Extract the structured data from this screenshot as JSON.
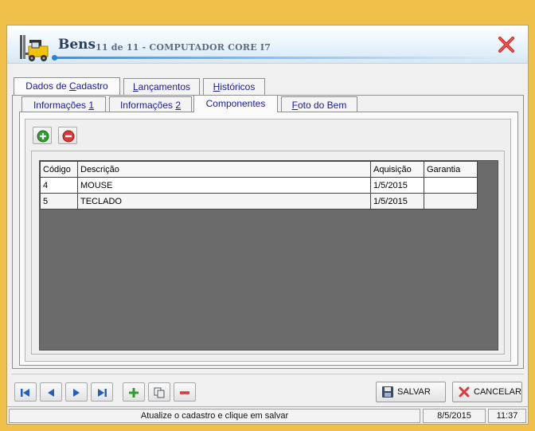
{
  "header": {
    "title": "Bens",
    "subtitle": "11 de 11 - COMPUTADOR CORE I7"
  },
  "tabs_top": [
    {
      "label_pre": "Dados de ",
      "label_u": "C",
      "label_post": "adastro"
    },
    {
      "label_pre": "",
      "label_u": "L",
      "label_post": "ançamentos"
    },
    {
      "label_pre": "",
      "label_u": "H",
      "label_post": "istóricos"
    }
  ],
  "tabs_sub": [
    {
      "label_pre": "Informações ",
      "label_u": "1",
      "label_post": ""
    },
    {
      "label_pre": "Informações ",
      "label_u": "2",
      "label_post": ""
    },
    {
      "label_pre": "",
      "label_u": "",
      "label_post": "Componentes"
    },
    {
      "label_pre": "",
      "label_u": "F",
      "label_post": "oto do Bem"
    }
  ],
  "grid": {
    "columns": [
      "Código",
      "Descrição",
      "Aquisição",
      "Garantia"
    ],
    "rows": [
      [
        "4",
        "MOUSE",
        "1/5/2015",
        ""
      ],
      [
        "5",
        "TECLADO",
        "1/5/2015",
        ""
      ]
    ]
  },
  "buttons": {
    "save": "SALVAR",
    "cancel": "CANCELAR"
  },
  "status": {
    "message": "Atualize o cadastro e clique em salvar",
    "date": "8/5/2015",
    "time": "11:37"
  },
  "colors": {
    "frame": "#f0c04b",
    "accent_blue": "#2f7fd1",
    "add_green": "#2f9e2f",
    "remove_red": "#d93a3a"
  }
}
